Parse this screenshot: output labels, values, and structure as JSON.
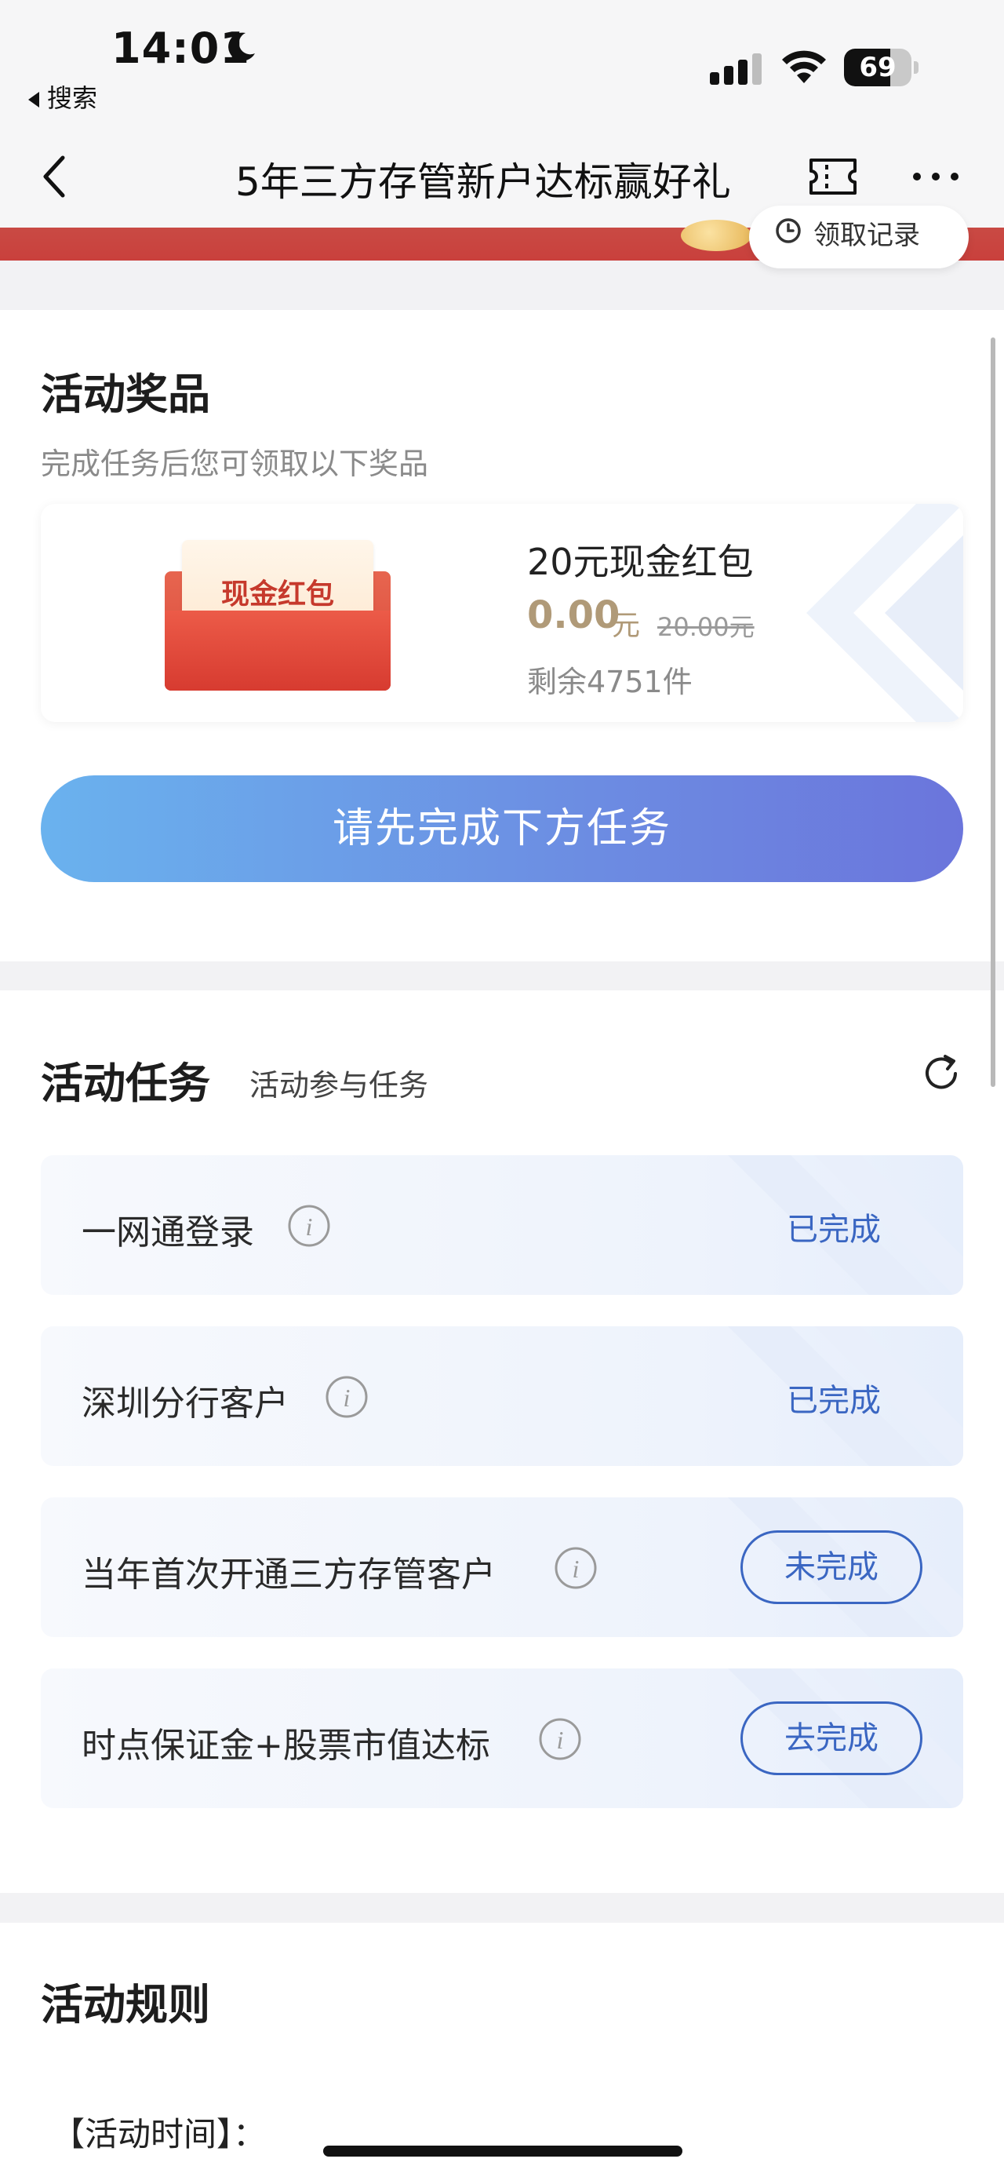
{
  "status_bar": {
    "time": "14:01",
    "back_app": "搜索",
    "battery_level": "69",
    "battery_fraction": 0.69
  },
  "nav": {
    "title": "5年三方存管新户达标赢好礼"
  },
  "banner": {
    "record_label": "领取记录"
  },
  "prize_section": {
    "title": "活动奖品",
    "subtitle": "完成任务后您可领取以下奖品",
    "envelope_label": "现金红包",
    "prize_name": "20元现金红包",
    "price": "0.00",
    "price_unit": "元",
    "original_price": "20.00元",
    "stock": "剩余4751件",
    "button_label": "请先完成下方任务"
  },
  "task_section": {
    "title": "活动任务",
    "subtitle": "活动参与任务",
    "tasks": [
      {
        "label": "一网通登录",
        "status": "已完成",
        "is_button": false
      },
      {
        "label": "深圳分行客户",
        "status": "已完成",
        "is_button": false
      },
      {
        "label": "当年首次开通三方存管客户",
        "status": "未完成",
        "is_button": true
      },
      {
        "label": "时点保证金+股票市值达标",
        "status": "去完成",
        "is_button": true
      }
    ]
  },
  "rules_section": {
    "title": "活动规则",
    "time_label": "【活动时间】："
  },
  "colors": {
    "accent_blue": "#3a66c2",
    "button_gradient_start": "#6ab2ee",
    "button_gradient_end": "#6b75dc",
    "banner_red": "#c9403c",
    "price_gold": "#b09a78"
  }
}
